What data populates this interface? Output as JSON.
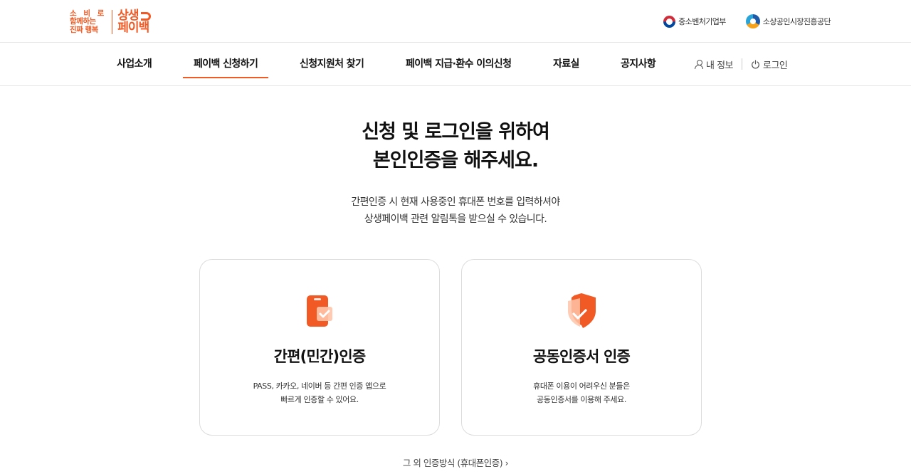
{
  "brand": {
    "slogan": [
      "소 비 로",
      "함께하는",
      "진짜 행복"
    ],
    "name_top": "상생",
    "name_bottom": "페이백",
    "accent_color": "#f15a24"
  },
  "partners": [
    {
      "label": "중소벤처기업부",
      "icon": "taegeuk-emblem-icon"
    },
    {
      "label": "소상공인시장진흥공단",
      "icon": "semas-emblem-icon"
    }
  ],
  "nav": {
    "items": [
      "사업소개",
      "페이백 신청하기",
      "신청지원처 찾기",
      "페이백 지급·환수 이의신청",
      "자료실",
      "공지사항"
    ],
    "active_index": 1,
    "my_info": "내 정보",
    "login": "로그인"
  },
  "hero": {
    "headline_line1": "신청 및 로그인을 위하여",
    "headline_line2": "본인인증을 해주세요.",
    "sub_line1": "간편인증 시 현재 사용중인 휴대폰 번호를 입력하셔야",
    "sub_line2": "상생페이백 관련 알림톡을 받으실 수 있습니다."
  },
  "cards": [
    {
      "title": "간편(민간)인증",
      "desc_line1": "PASS, 카카오, 네이버 등 간편 인증 앱으로",
      "desc_line2": "빠르게 인증할 수 있어요.",
      "icon": "phone-check-icon"
    },
    {
      "title": "공동인증서 인증",
      "desc_line1": "휴대폰 이용이 어려우신 분들은",
      "desc_line2": "공동인증서를 이용해 주세요.",
      "icon": "shield-check-icon"
    }
  ],
  "other_auth": {
    "label": "그 외 인증방식 (휴대폰인증)",
    "arrow": "›"
  }
}
